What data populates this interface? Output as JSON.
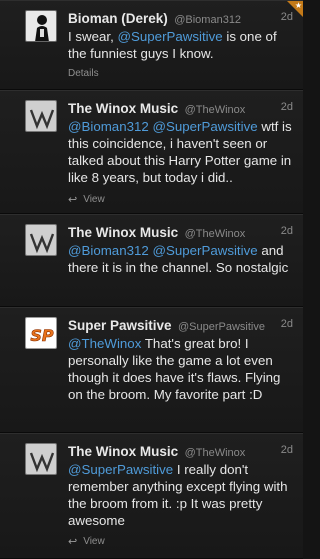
{
  "tweets": [
    {
      "name": "Bioman (Derek)",
      "handle": "@Bioman312",
      "time": "2d",
      "avatar": "bioman-avatar",
      "text_parts": [
        {
          "t": "I swear, "
        },
        {
          "t": "@SuperPawsitive",
          "mention": true
        },
        {
          "t": " is one of the funniest guys I know."
        }
      ],
      "meta_label": "Details",
      "meta_icon": "",
      "favorited": true,
      "corner_glyph": "★"
    },
    {
      "name": "The Winox Music",
      "handle": "@TheWinox",
      "time": "2d",
      "avatar": "winox-avatar",
      "text_parts": [
        {
          "t": "@Bioman312",
          "mention": true
        },
        {
          "t": " "
        },
        {
          "t": "@SuperPawsitive",
          "mention": true
        },
        {
          "t": " wtf is this coincidence, i haven't seen or talked about this Harry Potter game in like 8 years, but today i did.."
        }
      ],
      "meta_label": "View",
      "meta_icon": "↩"
    },
    {
      "name": "The Winox Music",
      "handle": "@TheWinox",
      "time": "2d",
      "avatar": "winox-avatar",
      "text_parts": [
        {
          "t": "@Bioman312",
          "mention": true
        },
        {
          "t": " "
        },
        {
          "t": "@SuperPawsitive",
          "mention": true
        },
        {
          "t": " and there it is in the channel. So nostalgic"
        }
      ],
      "meta_label": "View",
      "meta_icon": "↩"
    },
    {
      "name": "Super Pawsitive",
      "handle": "@SuperPawsitive",
      "time": "2d",
      "avatar": "superpawsitive-avatar",
      "avatar_text": "SP",
      "text_parts": [
        {
          "t": "@TheWinox",
          "mention": true
        },
        {
          "t": " That's great bro! I personally like the game a lot even though it does have it's flaws. Flying on the broom. My favorite part :D"
        }
      ],
      "meta_label": "",
      "meta_icon": ""
    },
    {
      "name": "The Winox Music",
      "handle": "@TheWinox",
      "time": "2d",
      "avatar": "winox-avatar",
      "text_parts": [
        {
          "t": "@SuperPawsitive",
          "mention": true
        },
        {
          "t": " I really don't remember anything except flying with the broom from it. :p It was pretty awesome"
        }
      ],
      "meta_label": "View",
      "meta_icon": "↩"
    }
  ]
}
